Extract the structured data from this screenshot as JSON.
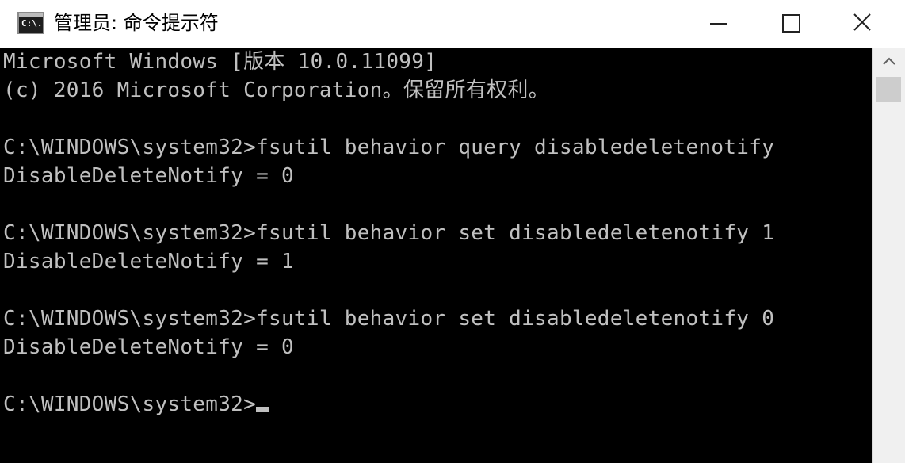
{
  "window": {
    "title": "管理员: 命令提示符",
    "icon_text": "C:\\.",
    "icon": "cmd-console-icon"
  },
  "controls": {
    "minimize": "minimize-icon",
    "maximize": "maximize-icon",
    "close": "close-icon"
  },
  "console": {
    "background": "#000000",
    "foreground": "#c0c0c0",
    "lines": [
      "Microsoft Windows [版本 10.0.11099]",
      "(c) 2016 Microsoft Corporation。保留所有权利。",
      "",
      "C:\\WINDOWS\\system32>fsutil behavior query disabledeletenotify",
      "DisableDeleteNotify = 0",
      "",
      "C:\\WINDOWS\\system32>fsutil behavior set disabledeletenotify 1",
      "DisableDeleteNotify = 1",
      "",
      "C:\\WINDOWS\\system32>fsutil behavior set disabledeletenotify 0",
      "DisableDeleteNotify = 0",
      "",
      "C:\\WINDOWS\\system32>"
    ]
  },
  "scrollbar": {
    "up_arrow": "chevron-up-icon"
  }
}
